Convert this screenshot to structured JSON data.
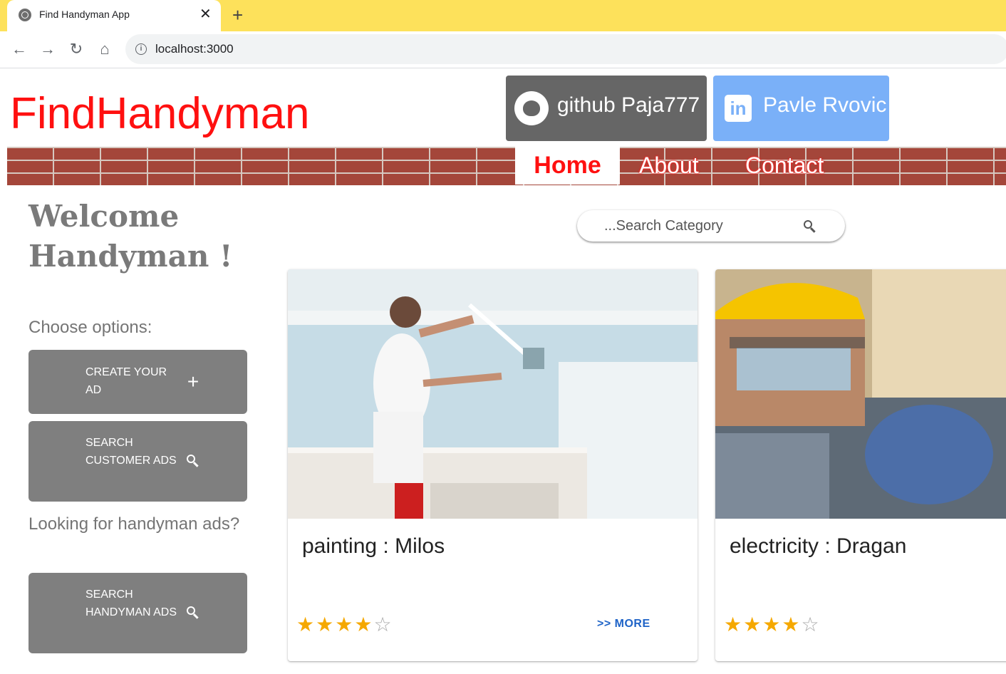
{
  "browser": {
    "tab_title": "Find Handyman App",
    "new_tab": "+",
    "url": "localhost:3000"
  },
  "header": {
    "logo": "FindHandyman",
    "github_label": "github Paja777",
    "linkedin_label": "Pavle Rvovic"
  },
  "nav": {
    "home": "Home",
    "about": "About",
    "contact": "Contact"
  },
  "sidebar": {
    "welcome": "Welcome Handyman !",
    "choose": "Choose options:",
    "create_ad": "CREATE YOUR AD",
    "search_customer_ads": "SEARCH CUSTOMER ADS",
    "looking": "Looking for handyman ads?",
    "search_handyman_ads": "SEARCH HANDYMAN ADS"
  },
  "search": {
    "placeholder": "...Search Category"
  },
  "cards": [
    {
      "title": "painting : Milos",
      "rating": 4,
      "max_rating": 5,
      "more": ">> MORE"
    },
    {
      "title": "electricity : Dragan",
      "rating": 4,
      "max_rating": 5
    }
  ],
  "colors": {
    "logo": "#ff1010",
    "tabbar": "#fde15b",
    "github": "#666666",
    "linkedin": "#7ab0f8",
    "button_gray": "#7f7f7f",
    "star": "#f5a800",
    "link": "#1e63c7"
  }
}
